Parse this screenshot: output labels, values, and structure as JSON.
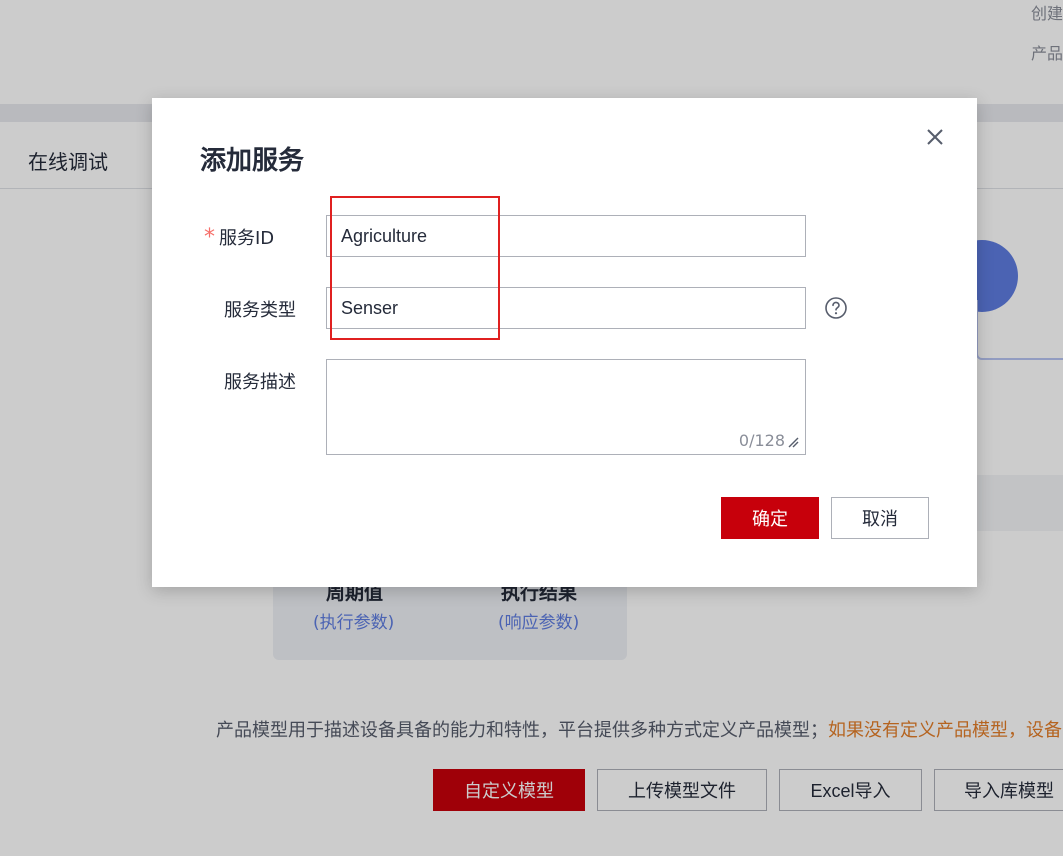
{
  "background": {
    "top_right_lines": [
      "创建",
      "产品"
    ],
    "tab_label": "在线调试",
    "param_items": [
      {
        "title": "周期值",
        "sub": "(执行参数)"
      },
      {
        "title": "执行结果",
        "sub": "(响应参数)"
      }
    ],
    "description": "产品模型用于描述设备具备的能力和特性，平台提供多种方式定义产品模型；",
    "description_link": "如果没有定义产品模型，设备",
    "buttons": {
      "custom_model": "自定义模型",
      "upload_model": "上传模型文件",
      "excel_import": "Excel导入",
      "import_library": "导入库模型"
    }
  },
  "dialog": {
    "title": "添加服务",
    "fields": {
      "service_id": {
        "label": "服务ID",
        "value": "Agriculture",
        "required": true
      },
      "service_type": {
        "label": "服务类型",
        "value": "Senser"
      },
      "service_desc": {
        "label": "服务描述",
        "value": "",
        "count": "0/128"
      }
    },
    "ok_label": "确定",
    "cancel_label": "取消"
  },
  "colors": {
    "primary": "#c7000b",
    "accent_blue": "#5e7ce0",
    "highlight": "#e02020",
    "link_orange": "#e37d29"
  }
}
